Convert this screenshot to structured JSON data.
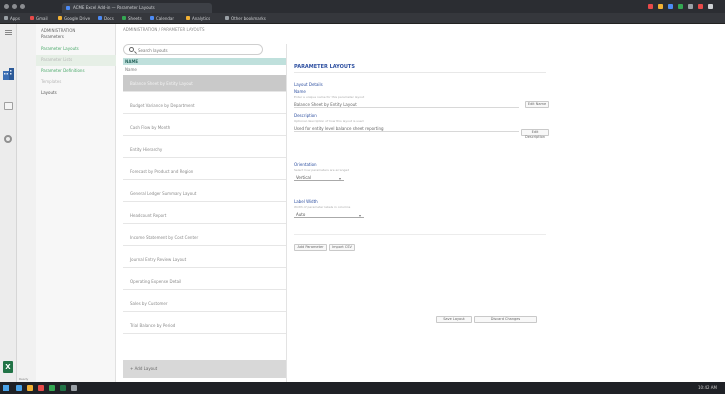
{
  "browser": {
    "tab_title": "ACME Excel Add-in — Parameter Layouts",
    "bookmarks": [
      "Apps",
      "Gmail",
      "Google Drive",
      "Docs",
      "Sheets",
      "Calendar",
      "Analytics",
      "Other bookmarks"
    ],
    "extension_colors": [
      "#e84a4a",
      "#f2b134",
      "#4c8bf5",
      "#34a853",
      "#9aa0a6",
      "#e84a4a",
      "#cfd1d4"
    ]
  },
  "nav": {
    "title": "ADMINISTRATION",
    "items": [
      {
        "label": "Parameters",
        "style": "head"
      },
      {
        "label": "Parameter Layouts",
        "style": "link"
      },
      {
        "label": "Parameter Lists",
        "style": "dim"
      },
      {
        "label": "Parameter Definitions",
        "style": "link"
      },
      {
        "label": "Templates",
        "style": "dim"
      },
      {
        "label": "Layouts",
        "style": "head"
      }
    ]
  },
  "breadcrumb": "ADMINISTRATION / PARAMETER LAYOUTS",
  "list": {
    "search_placeholder": "Search layouts",
    "header": "NAME",
    "subheader": "Name",
    "items": [
      "Balance Sheet by Entity Layout",
      "Budget Variance by Department",
      "Cash Flow by Month",
      "Entity Hierarchy",
      "Forecast by Product and Region",
      "General Ledger Summary Layout",
      "Headcount Report",
      "Income Statement by Cost Center",
      "Journal Entry Review Layout",
      "Operating Expense Detail",
      "Sales by Customer",
      "Trial Balance by Period"
    ],
    "selected_index": 0,
    "footer": "+ Add Layout"
  },
  "details": {
    "heading": "PARAMETER LAYOUTS",
    "section_label": "Layout Details",
    "name_label": "Name",
    "name_hint": "Enter a unique name for this parameter layout",
    "name_value": "Balance Sheet by Entity Layout",
    "name_button": "Edit Name",
    "desc_label": "Description",
    "desc_hint": "Optional description of how this layout is used",
    "desc_value": "Used for entity level balance sheet reporting",
    "desc_button": "Edit Description",
    "orientation_label": "Orientation",
    "orientation_hint": "Select how parameters are arranged",
    "orientation_value": "Vertical",
    "rows_label": "Label Width",
    "rows_hint": "Width of parameter labels in columns",
    "rows_value": "Auto",
    "action_add": "Add Parameter",
    "action_import": "Import CSV",
    "save_label": "Save Layout",
    "cancel_label": "Discard Changes"
  },
  "status": "Ready",
  "taskbar": {
    "clock": "10:42 AM",
    "icon_colors": [
      "#4aa3e8",
      "#f2b134",
      "#e84a4a",
      "#34a853",
      "#217346",
      "#9aa0a6"
    ]
  }
}
